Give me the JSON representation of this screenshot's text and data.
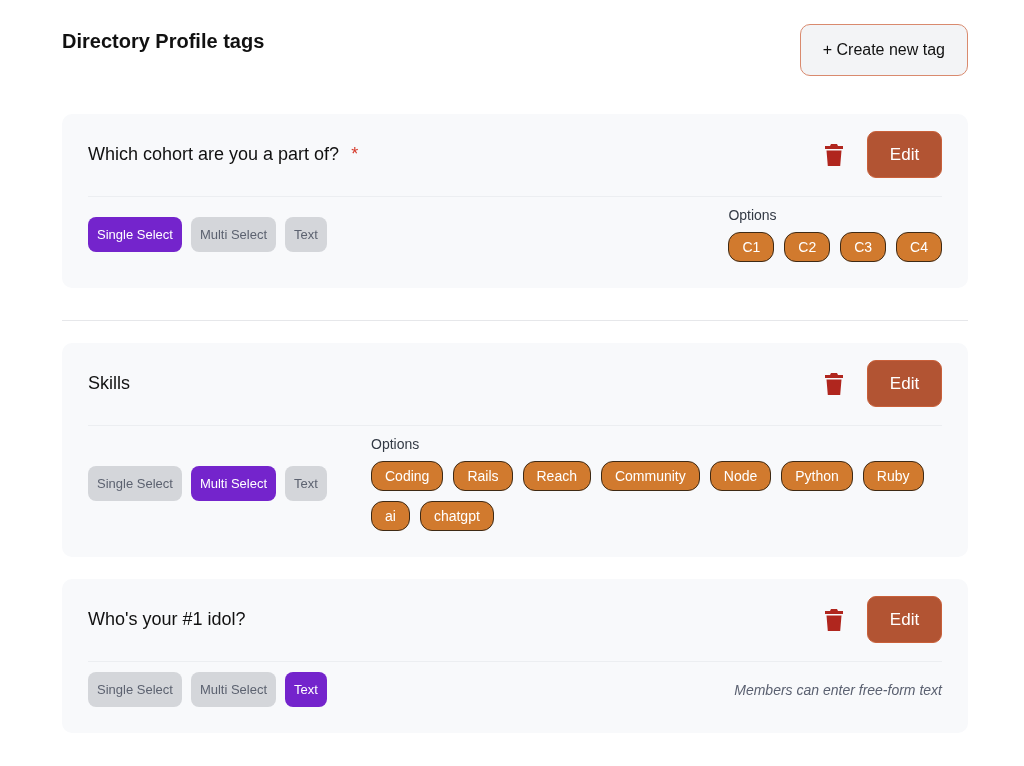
{
  "page": {
    "title": "Directory Profile tags",
    "create_button": "+ Create new tag"
  },
  "tags": [
    {
      "title": "Which cohort are you a part of?",
      "required_mark": "*",
      "divider_before": false,
      "edit": "Edit",
      "types": [
        {
          "label": "Single Select",
          "selected": true
        },
        {
          "label": "Multi Select",
          "selected": false
        },
        {
          "label": "Text",
          "selected": false
        }
      ],
      "detail": {
        "kind": "options",
        "label": "Options",
        "chips": [
          "C1",
          "C2",
          "C3",
          "C4"
        ]
      }
    },
    {
      "title": "Skills",
      "divider_before": true,
      "edit": "Edit",
      "types": [
        {
          "label": "Single Select",
          "selected": false
        },
        {
          "label": "Multi Select",
          "selected": true
        },
        {
          "label": "Text",
          "selected": false
        }
      ],
      "detail": {
        "kind": "options",
        "label": "Options",
        "chips": [
          "Coding",
          "Rails",
          "Reach",
          "Community",
          "Node",
          "Python",
          "Ruby",
          "ai",
          "chatgpt"
        ]
      }
    },
    {
      "title": "Who's your #1 idol?",
      "divider_before": false,
      "edit": "Edit",
      "types": [
        {
          "label": "Single Select",
          "selected": false
        },
        {
          "label": "Multi Select",
          "selected": false
        },
        {
          "label": "Text",
          "selected": true
        }
      ],
      "detail": {
        "kind": "note",
        "text": "Members can enter free-form text"
      }
    }
  ]
}
